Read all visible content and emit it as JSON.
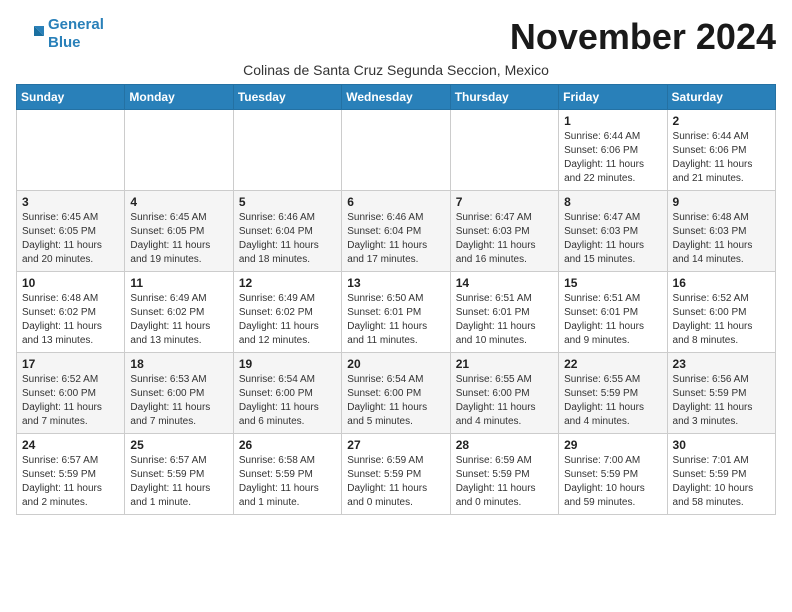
{
  "header": {
    "logo_line1": "General",
    "logo_line2": "Blue",
    "month_title": "November 2024",
    "subtitle": "Colinas de Santa Cruz Segunda Seccion, Mexico"
  },
  "weekdays": [
    "Sunday",
    "Monday",
    "Tuesday",
    "Wednesday",
    "Thursday",
    "Friday",
    "Saturday"
  ],
  "weeks": [
    [
      {
        "day": "",
        "info": ""
      },
      {
        "day": "",
        "info": ""
      },
      {
        "day": "",
        "info": ""
      },
      {
        "day": "",
        "info": ""
      },
      {
        "day": "",
        "info": ""
      },
      {
        "day": "1",
        "info": "Sunrise: 6:44 AM\nSunset: 6:06 PM\nDaylight: 11 hours\nand 22 minutes."
      },
      {
        "day": "2",
        "info": "Sunrise: 6:44 AM\nSunset: 6:06 PM\nDaylight: 11 hours\nand 21 minutes."
      }
    ],
    [
      {
        "day": "3",
        "info": "Sunrise: 6:45 AM\nSunset: 6:05 PM\nDaylight: 11 hours\nand 20 minutes."
      },
      {
        "day": "4",
        "info": "Sunrise: 6:45 AM\nSunset: 6:05 PM\nDaylight: 11 hours\nand 19 minutes."
      },
      {
        "day": "5",
        "info": "Sunrise: 6:46 AM\nSunset: 6:04 PM\nDaylight: 11 hours\nand 18 minutes."
      },
      {
        "day": "6",
        "info": "Sunrise: 6:46 AM\nSunset: 6:04 PM\nDaylight: 11 hours\nand 17 minutes."
      },
      {
        "day": "7",
        "info": "Sunrise: 6:47 AM\nSunset: 6:03 PM\nDaylight: 11 hours\nand 16 minutes."
      },
      {
        "day": "8",
        "info": "Sunrise: 6:47 AM\nSunset: 6:03 PM\nDaylight: 11 hours\nand 15 minutes."
      },
      {
        "day": "9",
        "info": "Sunrise: 6:48 AM\nSunset: 6:03 PM\nDaylight: 11 hours\nand 14 minutes."
      }
    ],
    [
      {
        "day": "10",
        "info": "Sunrise: 6:48 AM\nSunset: 6:02 PM\nDaylight: 11 hours\nand 13 minutes."
      },
      {
        "day": "11",
        "info": "Sunrise: 6:49 AM\nSunset: 6:02 PM\nDaylight: 11 hours\nand 13 minutes."
      },
      {
        "day": "12",
        "info": "Sunrise: 6:49 AM\nSunset: 6:02 PM\nDaylight: 11 hours\nand 12 minutes."
      },
      {
        "day": "13",
        "info": "Sunrise: 6:50 AM\nSunset: 6:01 PM\nDaylight: 11 hours\nand 11 minutes."
      },
      {
        "day": "14",
        "info": "Sunrise: 6:51 AM\nSunset: 6:01 PM\nDaylight: 11 hours\nand 10 minutes."
      },
      {
        "day": "15",
        "info": "Sunrise: 6:51 AM\nSunset: 6:01 PM\nDaylight: 11 hours\nand 9 minutes."
      },
      {
        "day": "16",
        "info": "Sunrise: 6:52 AM\nSunset: 6:00 PM\nDaylight: 11 hours\nand 8 minutes."
      }
    ],
    [
      {
        "day": "17",
        "info": "Sunrise: 6:52 AM\nSunset: 6:00 PM\nDaylight: 11 hours\nand 7 minutes."
      },
      {
        "day": "18",
        "info": "Sunrise: 6:53 AM\nSunset: 6:00 PM\nDaylight: 11 hours\nand 7 minutes."
      },
      {
        "day": "19",
        "info": "Sunrise: 6:54 AM\nSunset: 6:00 PM\nDaylight: 11 hours\nand 6 minutes."
      },
      {
        "day": "20",
        "info": "Sunrise: 6:54 AM\nSunset: 6:00 PM\nDaylight: 11 hours\nand 5 minutes."
      },
      {
        "day": "21",
        "info": "Sunrise: 6:55 AM\nSunset: 6:00 PM\nDaylight: 11 hours\nand 4 minutes."
      },
      {
        "day": "22",
        "info": "Sunrise: 6:55 AM\nSunset: 5:59 PM\nDaylight: 11 hours\nand 4 minutes."
      },
      {
        "day": "23",
        "info": "Sunrise: 6:56 AM\nSunset: 5:59 PM\nDaylight: 11 hours\nand 3 minutes."
      }
    ],
    [
      {
        "day": "24",
        "info": "Sunrise: 6:57 AM\nSunset: 5:59 PM\nDaylight: 11 hours\nand 2 minutes."
      },
      {
        "day": "25",
        "info": "Sunrise: 6:57 AM\nSunset: 5:59 PM\nDaylight: 11 hours\nand 1 minute."
      },
      {
        "day": "26",
        "info": "Sunrise: 6:58 AM\nSunset: 5:59 PM\nDaylight: 11 hours\nand 1 minute."
      },
      {
        "day": "27",
        "info": "Sunrise: 6:59 AM\nSunset: 5:59 PM\nDaylight: 11 hours\nand 0 minutes."
      },
      {
        "day": "28",
        "info": "Sunrise: 6:59 AM\nSunset: 5:59 PM\nDaylight: 11 hours\nand 0 minutes."
      },
      {
        "day": "29",
        "info": "Sunrise: 7:00 AM\nSunset: 5:59 PM\nDaylight: 10 hours\nand 59 minutes."
      },
      {
        "day": "30",
        "info": "Sunrise: 7:01 AM\nSunset: 5:59 PM\nDaylight: 10 hours\nand 58 minutes."
      }
    ]
  ]
}
